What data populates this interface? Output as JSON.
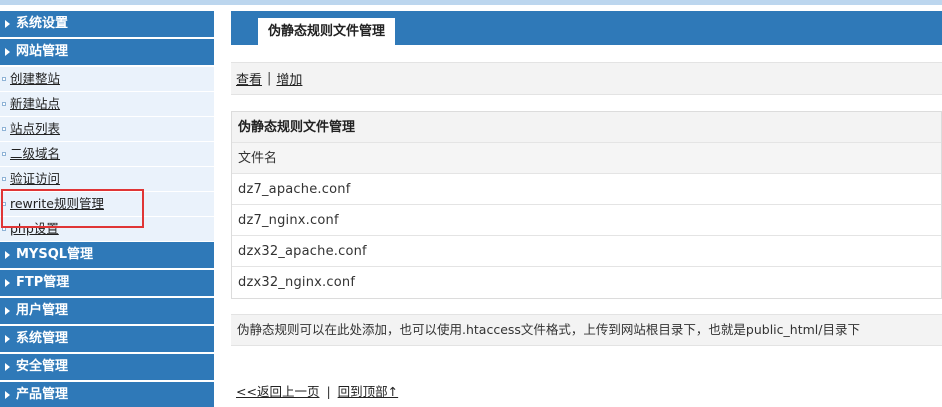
{
  "sidebar": {
    "sections_top": [
      {
        "label": "系统设置"
      },
      {
        "label": "网站管理"
      }
    ],
    "sub_items": [
      {
        "label": "创建整站"
      },
      {
        "label": "新建站点"
      },
      {
        "label": "站点列表"
      },
      {
        "label": "二级域名"
      },
      {
        "label": "验证访问"
      },
      {
        "label": "rewrite规则管理"
      },
      {
        "label": "php设置"
      }
    ],
    "sections_bottom": [
      {
        "label": "MYSQL管理"
      },
      {
        "label": "FTP管理"
      },
      {
        "label": "用户管理"
      },
      {
        "label": "系统管理"
      },
      {
        "label": "安全管理"
      },
      {
        "label": "产品管理"
      }
    ]
  },
  "main": {
    "title": "伪静态规则文件管理",
    "toolbar": {
      "view_label": "查看",
      "separator": "|",
      "add_label": "增加"
    },
    "table": {
      "caption": "伪静态规则文件管理",
      "column_header": "文件名",
      "rows": [
        "dz7_apache.conf",
        "dz7_nginx.conf",
        "dzx32_apache.conf",
        "dzx32_nginx.conf"
      ]
    },
    "note": "伪静态规则可以在此处添加，也可以使用.htaccess文件格式，上传到网站根目录下，也就是public_html/目录下",
    "footer": {
      "back_label": "<<返回上一页",
      "separator": "|",
      "top_label": "回到顶部↑"
    }
  },
  "colors": {
    "header_blue": "#2f79b8",
    "highlight_red": "#e03535",
    "sidebar_bg": "#eaf2fb"
  }
}
